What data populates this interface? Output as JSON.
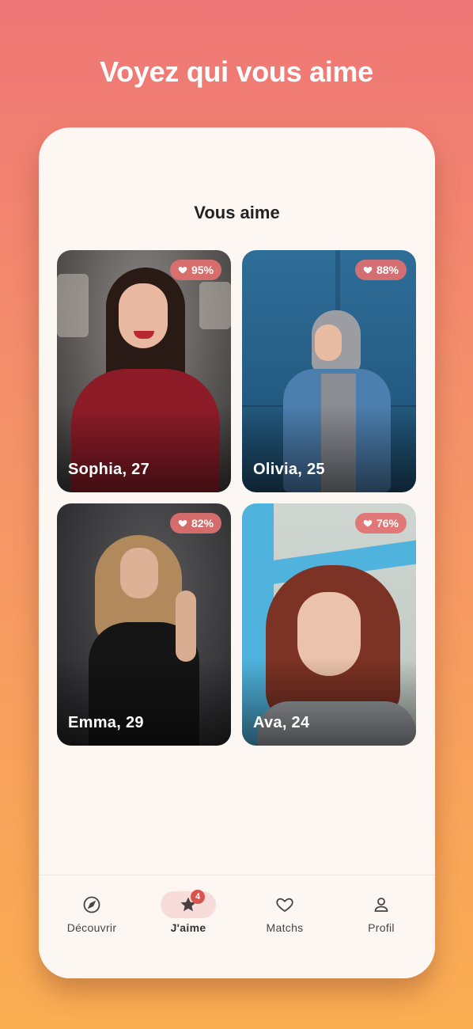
{
  "headline": "Voyez qui vous aime",
  "screen": {
    "title": "Vous aime"
  },
  "profiles": [
    {
      "name": "Sophia, 27",
      "match": "95%"
    },
    {
      "name": "Olivia, 25",
      "match": "88%"
    },
    {
      "name": "Emma, 29",
      "match": "82%"
    },
    {
      "name": "Ava, 24",
      "match": "76%"
    }
  ],
  "nav": {
    "items": [
      {
        "label": "Découvrir",
        "icon": "compass-icon"
      },
      {
        "label": "J'aime",
        "icon": "star-icon",
        "badge": "4",
        "active": true
      },
      {
        "label": "Matchs",
        "icon": "heart-icon"
      },
      {
        "label": "Profil",
        "icon": "user-icon"
      }
    ]
  },
  "colors": {
    "accent": "#d9534f",
    "badge_bg": "#e27070",
    "active_pill": "#f8dcd9"
  }
}
